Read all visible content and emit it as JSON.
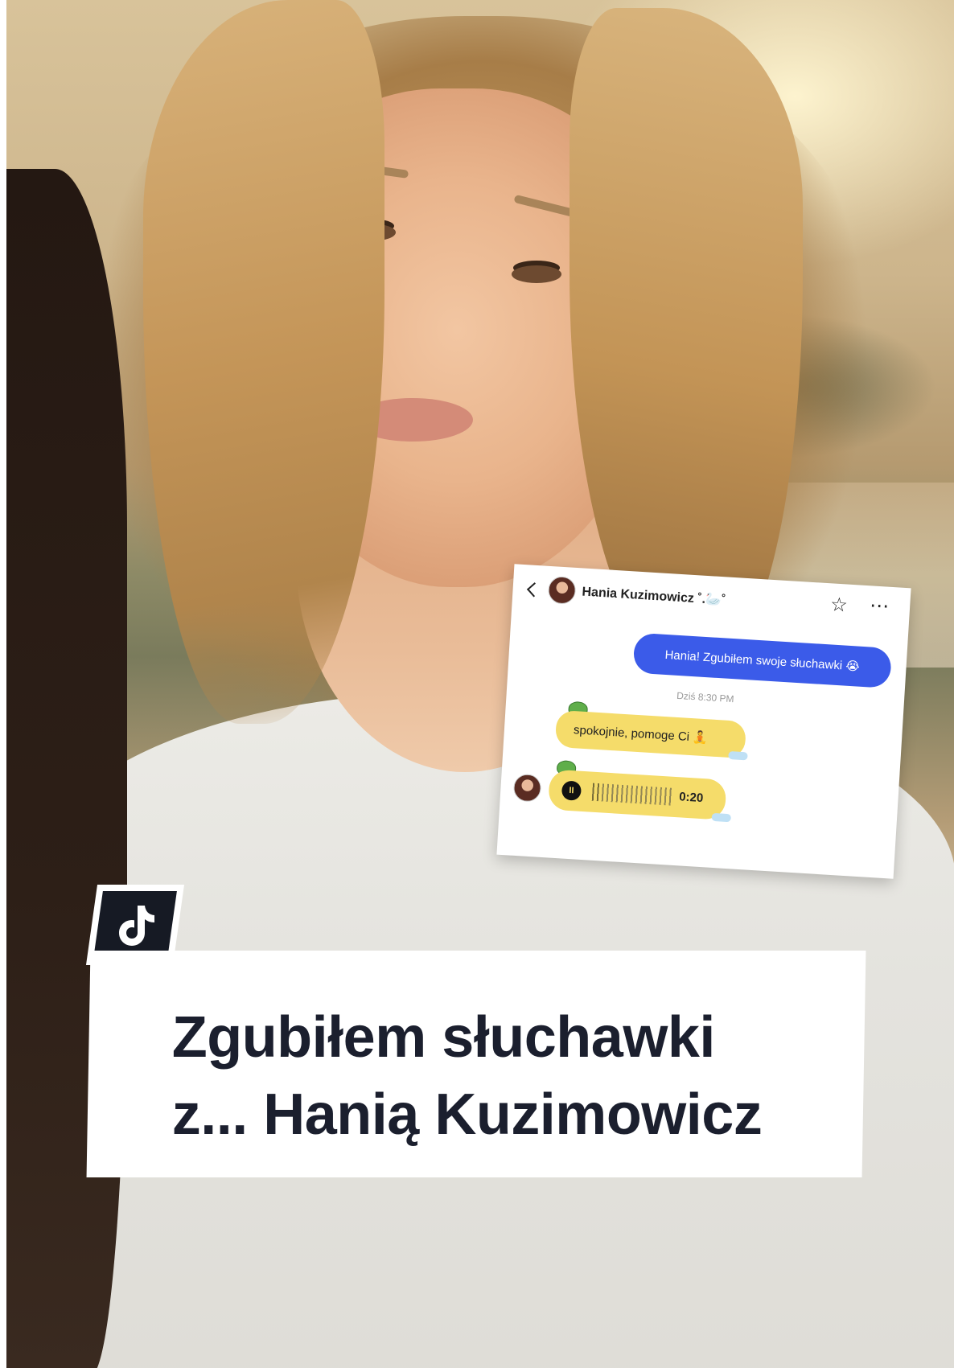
{
  "chat": {
    "contact_name": "Hania Kuzimowicz ˚.🦢˚",
    "outgoing_message": "Hania! Zgubiłem swoje słuchawki 😭",
    "timestamp": "Dziś 8:30 PM",
    "incoming_message": "spokojnie, pomoge Ci 🧘",
    "voice_duration": "0:20",
    "voice_pause_glyph": "II"
  },
  "headline": {
    "line1": "Zgubiłem słuchawki",
    "line2": "z... Hanią Kuzimowicz"
  },
  "icons": {
    "back": "chevron-left-icon",
    "star": "star-icon",
    "more": "more-icon",
    "tiktok": "tiktok-logo-icon"
  },
  "colors": {
    "outgoing_bubble": "#3b5be9",
    "incoming_bubble": "#f5dc6a",
    "headline_text": "#1b1f2e",
    "tiktok_badge": "#161a24"
  }
}
